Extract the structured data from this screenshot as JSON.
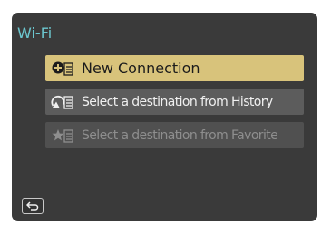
{
  "screen": {
    "title": "Wi-Fi",
    "items": [
      {
        "label": "New Connection",
        "icon": "plus-list-icon",
        "state": "selected"
      },
      {
        "label": "Select a destination from History",
        "icon": "history-list-icon",
        "state": "enabled"
      },
      {
        "label": "Select a destination from Favorite",
        "icon": "star-list-icon",
        "state": "disabled"
      }
    ],
    "back_icon": "return-arrow-icon"
  },
  "colors": {
    "background": "#3a3a3a",
    "title": "#6cc7cf",
    "selected": "#d8c37b",
    "item": "#5c5c5c",
    "disabled_item": "#505050"
  }
}
